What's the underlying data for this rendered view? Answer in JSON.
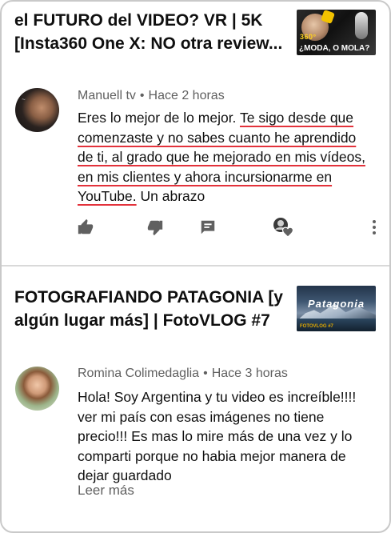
{
  "cards": [
    {
      "video_title": "el FUTURO del VIDEO? VR | 5K [Insta360 One X: NO otra review...",
      "thumbnail": {
        "top_text": "360°",
        "caption": "¿MODA, O MOLA?"
      },
      "comment": {
        "author": "Manuell tv",
        "time": "Hace 2 horas",
        "text_plain_start": "Eres lo mejor de lo mejor. ",
        "text_highlighted": "Te sigo desde que comenzaste y no sabes cuanto he aprendido de ti, al grado que he mejorado en mis vídeos, en mis clientes y ahora incursionarme en YouTube.",
        "text_plain_end": " Un abrazo",
        "highlight_color": "#e3323b"
      },
      "actions": {
        "like_icon": "thumbs-up-icon",
        "dislike_icon": "thumbs-down-icon",
        "reply_icon": "reply-comment-icon",
        "hearted_icon": "creator-heart-avatar-icon",
        "menu_icon": "more-vert-icon"
      }
    },
    {
      "video_title": "FOTOGRAFIANDO PATAGONIA [y algún lugar más] | FotoVLOG #7",
      "thumbnail": {
        "title_text": "Patagonia",
        "tag_text": "FOTOVLOG #7"
      },
      "comment": {
        "author": "Romina Colimedaglia",
        "time": "Hace 3 horas",
        "text": "Hola! Soy Argentina y tu video es increíble!!!! ver mi país con esas imágenes no tiene precio!!! Es mas lo mire más de una vez y lo comparti porque no habia mejor manera de dejar guardado",
        "read_more": "Leer más"
      }
    }
  ],
  "colors": {
    "text_primary": "#0f0f0f",
    "text_secondary": "#606060",
    "icon": "#606060",
    "divider": "#d9d9d9",
    "highlight": "#e3323b"
  }
}
